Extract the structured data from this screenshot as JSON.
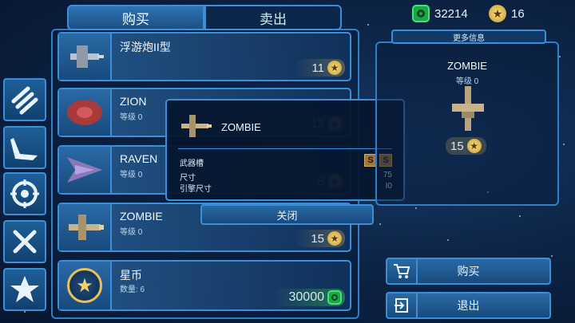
{
  "tabs": {
    "buy": "购买",
    "sell": "卖出"
  },
  "currency": {
    "gems": "32214",
    "stars": "16"
  },
  "sidebar": [
    {
      "icon": "missiles-icon"
    },
    {
      "icon": "ship-wing-icon"
    },
    {
      "icon": "crosshair-icon"
    },
    {
      "icon": "tools-icon"
    },
    {
      "icon": "star-icon"
    }
  ],
  "items": [
    {
      "name": "浮游炮II型",
      "level": "",
      "price": "11"
    },
    {
      "name": "ZION",
      "level": "等级 0",
      "price": "12"
    },
    {
      "name": "RAVEN",
      "level": "等级 0",
      "price": "5"
    },
    {
      "name": "ZOMBIE",
      "level": "等级 0",
      "price": "15"
    },
    {
      "name": "星币",
      "level": "数量: 6",
      "price": "30000"
    }
  ],
  "popup": {
    "title": "ZOMBIE",
    "stats": [
      {
        "label": "武器槽",
        "value": "S S"
      },
      {
        "label": "尺寸",
        "value": "75"
      },
      {
        "label": "引擎尺寸",
        "value": "I0"
      }
    ],
    "slots": [
      "S",
      "S"
    ],
    "close": "关闭"
  },
  "info": {
    "header": "更多信息",
    "name": "ZOMBIE",
    "level": "等级 0",
    "price": "15"
  },
  "actions": {
    "buy": "购买",
    "exit": "退出"
  },
  "colors": {
    "accent": "#3b8fd6",
    "gem": "#1ca64a",
    "star": "#e8c15a"
  }
}
